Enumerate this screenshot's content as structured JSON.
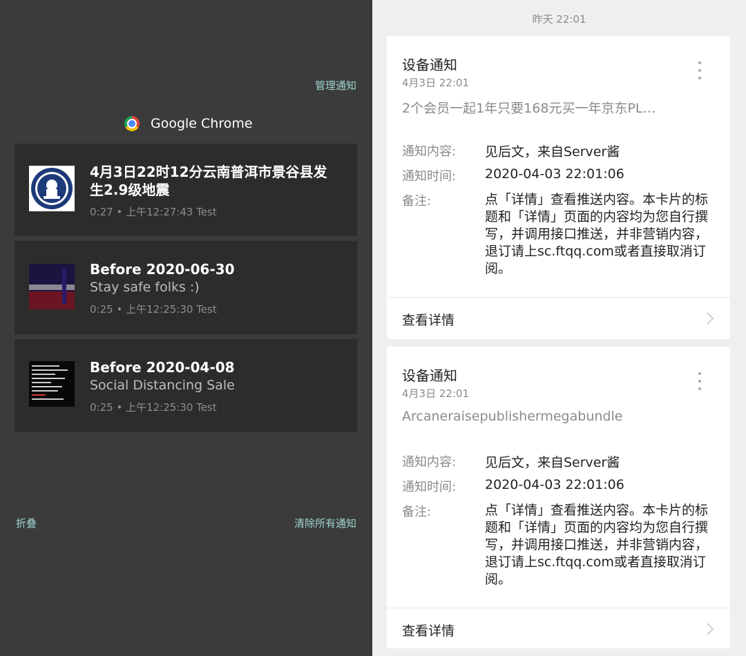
{
  "shade": {
    "manage_label": "管理通知",
    "collapse_label": "折叠",
    "clear_all_label": "清除所有通知",
    "app_name": "Google Chrome",
    "notifications": [
      {
        "title": "4月3日22时12分云南普洱市景谷县发生2.9级地震",
        "body": "",
        "meta": "0:27 • 上午12:27:43 Test"
      },
      {
        "title": "Before 2020-06-30",
        "body": "Stay safe folks :)",
        "meta": "0:25 • 上午12:25:30 Test"
      },
      {
        "title": "Before 2020-04-08",
        "body": "Social Distancing Sale",
        "meta": "0:25 • 上午12:25:30 Test"
      }
    ]
  },
  "chat": {
    "date_header": "昨天 22:01",
    "cards": [
      {
        "title": "设备通知",
        "date": "4月3日  22:01",
        "subtitle": "2个会员一起1年只要168元买一年京东PL…",
        "content_label": "通知内容:",
        "content_value": "见后文，来自Server酱",
        "time_label": "通知时间:",
        "time_value": "2020-04-03 22:01:06",
        "note_label": "备注:",
        "note_value": "点「详情」查看推送内容。本卡片的标题和「详情」页面的内容均为您自行撰写，并调用接口推送，并非营销内容，退订请上sc.ftqq.com或者直接取消订阅。",
        "action_label": "查看详情"
      },
      {
        "title": "设备通知",
        "date": "4月3日  22:01",
        "subtitle": "Arcaneraisepublishermegabundle",
        "content_label": "通知内容:",
        "content_value": "见后文，来自Server酱",
        "time_label": "通知时间:",
        "time_value": "2020-04-03 22:01:06",
        "note_label": "备注:",
        "note_value": "点「详情」查看推送内容。本卡片的标题和「详情」页面的内容均为您自行撰写，并调用接口推送，并非营销内容，退订请上sc.ftqq.com或者直接取消订阅。",
        "action_label": "查看详情"
      }
    ]
  }
}
